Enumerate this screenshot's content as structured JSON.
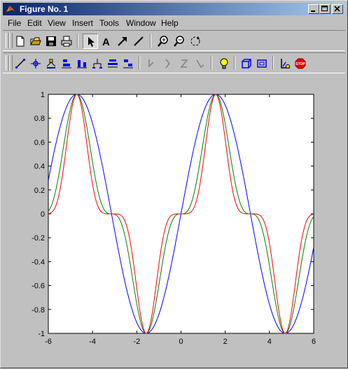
{
  "window": {
    "title": "Figure No. 1"
  },
  "menu": [
    {
      "label": "File"
    },
    {
      "label": "Edit"
    },
    {
      "label": "View"
    },
    {
      "label": "Insert"
    },
    {
      "label": "Tools"
    },
    {
      "label": "Window"
    },
    {
      "label": "Help"
    }
  ],
  "toolbar1": {
    "icons": [
      "new-file-icon",
      "open-folder-icon",
      "save-icon",
      "print-icon",
      "arrow-select-icon",
      "insert-text-icon",
      "insert-arrow-icon",
      "insert-line-icon",
      "zoom-in-icon",
      "zoom-out-icon",
      "rotate-3d-icon"
    ]
  },
  "toolbar2": {
    "icons": [
      "edit-plot-icon",
      "data-cursor-icon",
      "marker-icon",
      "align-icon",
      "distribute-icon",
      "bar-icon",
      "stack-icon",
      "group-icon",
      "light-icon",
      "box-icon",
      "box-outline-icon",
      "axes-icon",
      "stop-icon"
    ]
  },
  "colors": {
    "series1": "#0000ff",
    "series2": "#008000",
    "series3": "#ff0000"
  },
  "chart_data": {
    "type": "line",
    "xlim": [
      -6,
      6
    ],
    "ylim": [
      -1,
      1
    ],
    "xticks": [
      "-6",
      "-4",
      "-2",
      "0",
      "2",
      "4",
      "6"
    ],
    "yticks": [
      "1",
      "0.8",
      "0.6",
      "0.4",
      "0.2",
      "0",
      "-0.2",
      "-0.4",
      "-0.6",
      "-0.8",
      "-1"
    ],
    "grid": false,
    "series": [
      {
        "color": "#0000ff",
        "function": "sin(x)"
      },
      {
        "color": "#008000",
        "function": "sin(x)^3"
      },
      {
        "color": "#ff0000",
        "function": "sin(x)^5"
      }
    ]
  }
}
